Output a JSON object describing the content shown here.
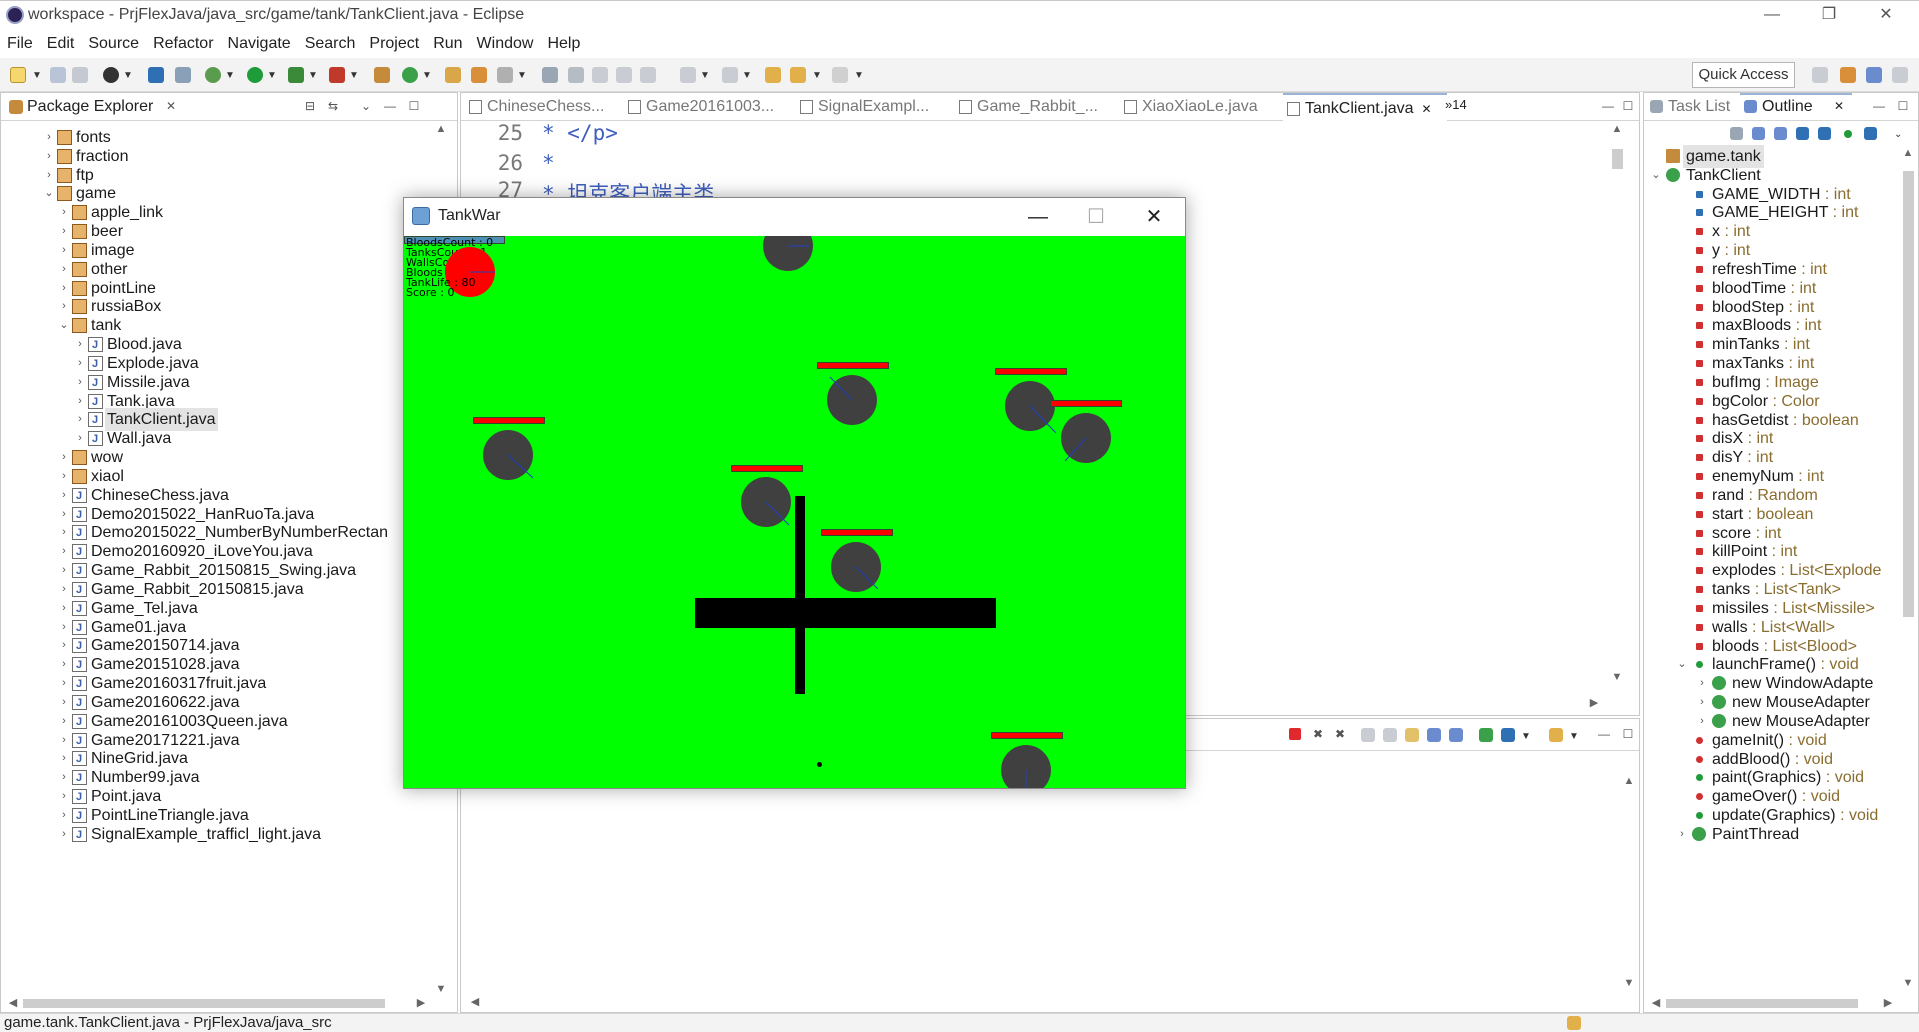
{
  "window": {
    "title": "workspace - PrjFlexJava/java_src/game/tank/TankClient.java - Eclipse",
    "controls": [
      "—",
      "❐",
      "✕"
    ]
  },
  "menu": [
    "File",
    "Edit",
    "Source",
    "Refactor",
    "Navigate",
    "Search",
    "Project",
    "Run",
    "Window",
    "Help"
  ],
  "toolbar": {
    "quick_access": "Quick Access"
  },
  "package_explorer": {
    "title": "Package Explorer",
    "rows": [
      {
        "label": "fonts",
        "indent": 1,
        "kind": "pkg",
        "twisty": "›"
      },
      {
        "label": "fraction",
        "indent": 1,
        "kind": "pkg",
        "twisty": "›"
      },
      {
        "label": "ftp",
        "indent": 1,
        "kind": "pkg",
        "twisty": "›"
      },
      {
        "label": "game",
        "indent": 1,
        "kind": "pkg",
        "twisty": "⌄"
      },
      {
        "label": "apple_link",
        "indent": 2,
        "kind": "pkg",
        "twisty": "›"
      },
      {
        "label": "beer",
        "indent": 2,
        "kind": "pkg",
        "twisty": "›"
      },
      {
        "label": "image",
        "indent": 2,
        "kind": "pkg",
        "twisty": "›"
      },
      {
        "label": "other",
        "indent": 2,
        "kind": "pkg",
        "twisty": "›"
      },
      {
        "label": "pointLine",
        "indent": 2,
        "kind": "pkg",
        "twisty": "›"
      },
      {
        "label": "russiaBox",
        "indent": 2,
        "kind": "pkg",
        "twisty": "›"
      },
      {
        "label": "tank",
        "indent": 2,
        "kind": "pkg",
        "twisty": "⌄"
      },
      {
        "label": "Blood.java",
        "indent": 3,
        "kind": "java",
        "twisty": "›"
      },
      {
        "label": "Explode.java",
        "indent": 3,
        "kind": "java",
        "twisty": "›"
      },
      {
        "label": "Missile.java",
        "indent": 3,
        "kind": "java",
        "twisty": "›"
      },
      {
        "label": "Tank.java",
        "indent": 3,
        "kind": "java",
        "twisty": "›"
      },
      {
        "label": "TankClient.java",
        "indent": 3,
        "kind": "java",
        "twisty": "›",
        "selected": true
      },
      {
        "label": "Wall.java",
        "indent": 3,
        "kind": "java",
        "twisty": "›"
      },
      {
        "label": "wow",
        "indent": 2,
        "kind": "pkg",
        "twisty": "›"
      },
      {
        "label": "xiaol",
        "indent": 2,
        "kind": "pkg",
        "twisty": "›"
      },
      {
        "label": "ChineseChess.java",
        "indent": 2,
        "kind": "java",
        "twisty": "›"
      },
      {
        "label": "Demo2015022_HanRuoTa.java",
        "indent": 2,
        "kind": "java",
        "twisty": "›"
      },
      {
        "label": "Demo2015022_NumberByNumberRectan",
        "indent": 2,
        "kind": "java",
        "twisty": "›"
      },
      {
        "label": "Demo20160920_iLoveYou.java",
        "indent": 2,
        "kind": "java",
        "twisty": "›"
      },
      {
        "label": "Game_Rabbit_20150815_Swing.java",
        "indent": 2,
        "kind": "java",
        "twisty": "›"
      },
      {
        "label": "Game_Rabbit_20150815.java",
        "indent": 2,
        "kind": "java",
        "twisty": "›"
      },
      {
        "label": "Game_Tel.java",
        "indent": 2,
        "kind": "java",
        "twisty": "›"
      },
      {
        "label": "Game01.java",
        "indent": 2,
        "kind": "java",
        "twisty": "›"
      },
      {
        "label": "Game20150714.java",
        "indent": 2,
        "kind": "java",
        "twisty": "›"
      },
      {
        "label": "Game20151028.java",
        "indent": 2,
        "kind": "java",
        "twisty": "›"
      },
      {
        "label": "Game20160317fruit.java",
        "indent": 2,
        "kind": "java",
        "twisty": "›"
      },
      {
        "label": "Game20160622.java",
        "indent": 2,
        "kind": "java",
        "twisty": "›"
      },
      {
        "label": "Game20161003Queen.java",
        "indent": 2,
        "kind": "java",
        "twisty": "›"
      },
      {
        "label": "Game20171221.java",
        "indent": 2,
        "kind": "java",
        "twisty": "›"
      },
      {
        "label": "NineGrid.java",
        "indent": 2,
        "kind": "java",
        "twisty": "›"
      },
      {
        "label": "Number99.java",
        "indent": 2,
        "kind": "java",
        "twisty": "›"
      },
      {
        "label": "Point.java",
        "indent": 2,
        "kind": "java",
        "twisty": "›"
      },
      {
        "label": "PointLineTriangle.java",
        "indent": 2,
        "kind": "java",
        "twisty": "›"
      },
      {
        "label": "SignalExample_trafficl_light.java",
        "indent": 2,
        "kind": "java",
        "twisty": "›"
      }
    ]
  },
  "editor": {
    "tabs": [
      "ChineseChess...",
      "Game20161003...",
      "SignalExampl...",
      "Game_Rabbit_...",
      "XiaoXiaoLe.java",
      "TankClient.java"
    ],
    "active_tab": "TankClient.java",
    "overflow": "»14",
    "lines": [
      {
        "num": "25",
        "text": "* </p>"
      },
      {
        "num": "26",
        "text": "*"
      },
      {
        "num": "27",
        "text": "* 坦克客户端主类"
      }
    ]
  },
  "outline": {
    "tab_tasklist": "Task List",
    "tab_outline": "Outline",
    "rows": [
      {
        "label": "game.tank",
        "type": "",
        "indent": 0,
        "icon": "package",
        "selected": true
      },
      {
        "label": "TankClient",
        "type": "",
        "indent": 0,
        "icon": "class",
        "twisty": "⌄"
      },
      {
        "label": "GAME_WIDTH",
        "type": " : int",
        "indent": 1,
        "icon": "static-final"
      },
      {
        "label": "GAME_HEIGHT",
        "type": " : int",
        "indent": 1,
        "icon": "static-final"
      },
      {
        "label": "x",
        "type": " : int",
        "indent": 1,
        "icon": "private-field"
      },
      {
        "label": "y",
        "type": " : int",
        "indent": 1,
        "icon": "private-field"
      },
      {
        "label": "refreshTime",
        "type": " : int",
        "indent": 1,
        "icon": "private-field"
      },
      {
        "label": "bloodTime",
        "type": " : int",
        "indent": 1,
        "icon": "private-field"
      },
      {
        "label": "bloodStep",
        "type": " : int",
        "indent": 1,
        "icon": "private-field"
      },
      {
        "label": "maxBloods",
        "type": " : int",
        "indent": 1,
        "icon": "private-field"
      },
      {
        "label": "minTanks",
        "type": " : int",
        "indent": 1,
        "icon": "private-field"
      },
      {
        "label": "maxTanks",
        "type": " : int",
        "indent": 1,
        "icon": "private-field"
      },
      {
        "label": "bufImg",
        "type": " : Image",
        "indent": 1,
        "icon": "private-field"
      },
      {
        "label": "bgColor",
        "type": " : Color",
        "indent": 1,
        "icon": "private-field"
      },
      {
        "label": "hasGetdist",
        "type": " : boolean",
        "indent": 1,
        "icon": "private-field"
      },
      {
        "label": "disX",
        "type": " : int",
        "indent": 1,
        "icon": "private-field"
      },
      {
        "label": "disY",
        "type": " : int",
        "indent": 1,
        "icon": "private-field"
      },
      {
        "label": "enemyNum",
        "type": " : int",
        "indent": 1,
        "icon": "private-field"
      },
      {
        "label": "rand",
        "type": " : Random",
        "indent": 1,
        "icon": "static-field"
      },
      {
        "label": "start",
        "type": " : boolean",
        "indent": 1,
        "icon": "private-field"
      },
      {
        "label": "score",
        "type": " : int",
        "indent": 1,
        "icon": "private-field"
      },
      {
        "label": "killPoint",
        "type": " : int",
        "indent": 1,
        "icon": "private-field"
      },
      {
        "label": "explodes",
        "type": " : List<Explode",
        "indent": 1,
        "icon": "private-field"
      },
      {
        "label": "tanks",
        "type": " : List<Tank>",
        "indent": 1,
        "icon": "private-field"
      },
      {
        "label": "missiles",
        "type": " : List<Missile>",
        "indent": 1,
        "icon": "private-field"
      },
      {
        "label": "walls",
        "type": " : List<Wall>",
        "indent": 1,
        "icon": "private-field"
      },
      {
        "label": "bloods",
        "type": " : List<Blood>",
        "indent": 1,
        "icon": "private-field"
      },
      {
        "label": "launchFrame()",
        "type": " : void",
        "indent": 1,
        "icon": "public-method",
        "twisty": "⌄"
      },
      {
        "label": "new WindowAdapte",
        "type": "",
        "indent": 2,
        "icon": "anon-class",
        "twisty": "›"
      },
      {
        "label": "new MouseAdapter",
        "type": "",
        "indent": 2,
        "icon": "anon-class",
        "twisty": "›"
      },
      {
        "label": "new MouseAdapter",
        "type": "",
        "indent": 2,
        "icon": "anon-class",
        "twisty": "›"
      },
      {
        "label": "gameInit()",
        "type": " : void",
        "indent": 1,
        "icon": "private-method"
      },
      {
        "label": "addBlood()",
        "type": " : void",
        "indent": 1,
        "icon": "private-method"
      },
      {
        "label": "paint(Graphics)",
        "type": " : void",
        "indent": 1,
        "icon": "public-method"
      },
      {
        "label": "gameOver()",
        "type": " : void",
        "indent": 1,
        "icon": "private-method"
      },
      {
        "label": "update(Graphics)",
        "type": " : void",
        "indent": 1,
        "icon": "public-method"
      },
      {
        "label": "PaintThread",
        "type": "",
        "indent": 1,
        "icon": "inner-class",
        "twisty": "›"
      }
    ]
  },
  "statusbar": {
    "text": "game.tank.TankClient.java - PrjFlexJava/java_src"
  },
  "tankwar": {
    "title": "TankWar",
    "controls": [
      "—",
      "☐",
      "✕"
    ],
    "hud": [
      "BloodsCount : 0",
      "TanksCount : 1",
      "WallsCount",
      "Bloods",
      "TankLife : 80",
      "Score : 0"
    ],
    "colors": {
      "background": "#00ff00",
      "player": "#ff0000",
      "enemy": "#404040",
      "wall": "#000000",
      "hp": "#ff0000"
    }
  }
}
